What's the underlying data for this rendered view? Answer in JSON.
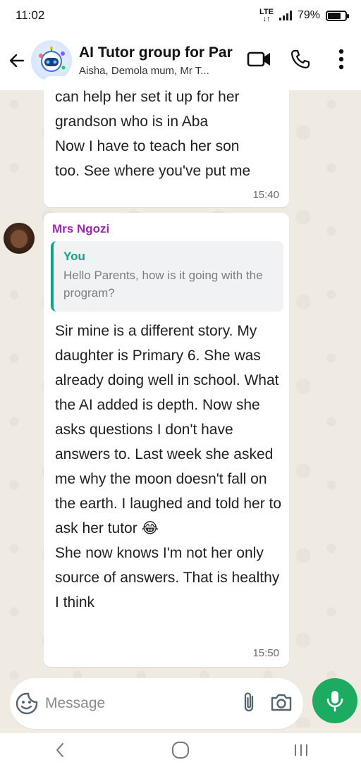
{
  "status_bar": {
    "time": "11:02",
    "network": "LTE",
    "battery": "79%"
  },
  "header": {
    "title": "AI Tutor group for Par",
    "members": "Aisha, Demola mum, Mr T..."
  },
  "messages": {
    "previous": {
      "text": "can help her set it up for her\ngrandson who is in Aba\nNow I have to teach her son\ntoo. See where you've put me",
      "time": "15:40"
    },
    "main": {
      "sender": "Mrs Ngozi",
      "quote_author": "You",
      "quote_text": "Hello Parents, how is it going with the program?",
      "text": "Sir mine is a different story. My daughter is Primary 6. She was already doing well in school. What the AI added is depth. Now she asks questions I don't have answers to. Last week she asked me why the moon doesn't fall on the earth. I laughed and told her to ask her tutor 😂\nShe now knows I'm not her only source of answers. That is healthy I think",
      "time": "15:50"
    }
  },
  "composer": {
    "placeholder": "Message"
  },
  "colors": {
    "accent_green": "#1daa61",
    "sender_purple": "#9c27b0",
    "quote_green": "#06a884"
  },
  "icons": [
    "back-arrow-icon",
    "video-call-icon",
    "phone-icon",
    "more-options-icon",
    "emoji-sticker-icon",
    "attach-icon",
    "camera-icon",
    "mic-icon",
    "nav-back-icon",
    "nav-home-icon",
    "nav-recents-icon"
  ]
}
